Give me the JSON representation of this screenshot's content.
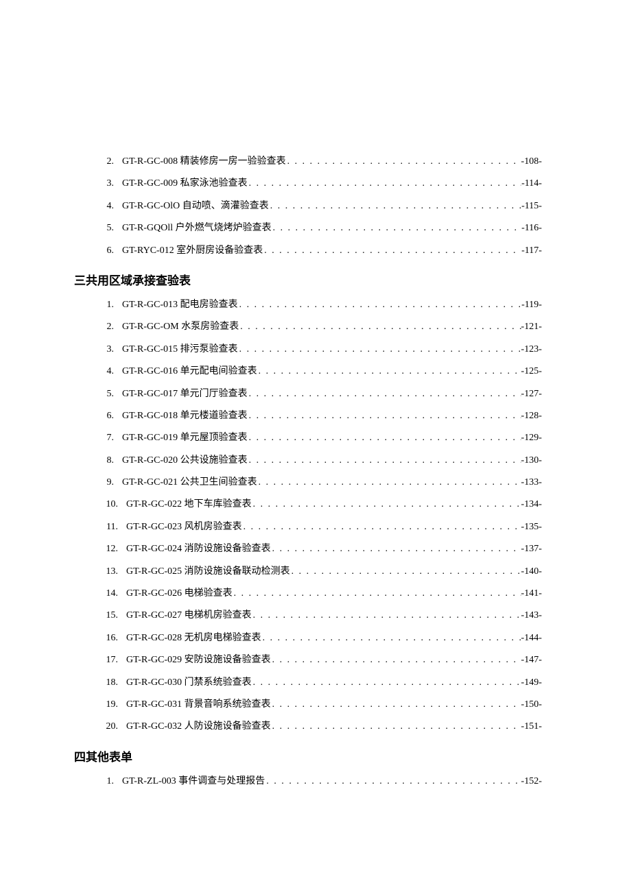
{
  "dots": ". . . . . . . . . . . . . . . . . . . . . . . . . . . . . . . . . . . . . . . . . . . . . . . . . . . . . . . . . . . . . . . .",
  "group1": {
    "items": [
      {
        "num": "2.",
        "title": "GT-R-GC-008 精装修房一房一验验查表",
        "page": "-108-"
      },
      {
        "num": "3.",
        "title": "GT-R-GC-009 私家泳池验查表",
        "page": "-114-"
      },
      {
        "num": "4.",
        "title": "GT-R-GC-OlO 自动喷、滴灌验查表",
        "page": "-115-"
      },
      {
        "num": "5.",
        "title": "GT-R-GQOll 户外燃气烧烤炉验查表",
        "page": "-116-"
      },
      {
        "num": "6.",
        "title": "GT-RYC-012 室外厨房设备验查表",
        "page": "-117-"
      }
    ]
  },
  "group2": {
    "heading": "三共用区域承接查验表",
    "items": [
      {
        "num": "1.",
        "title": "GT-R-GC-013 配电房验查表",
        "page": "-119-"
      },
      {
        "num": "2.",
        "title": "GT-R-GC-OM 水泵房验查表",
        "page": "-121-"
      },
      {
        "num": "3.",
        "title": "GT-R-GC-015 排污泵验查表",
        "page": "-123-"
      },
      {
        "num": "4.",
        "title": "GT-R-GC-016 单元配电间验查表",
        "page": "-125-"
      },
      {
        "num": "5.",
        "title": "GT-R-GC-017 单元门厅验查表",
        "page": "-127-"
      },
      {
        "num": "6.",
        "title": "GT-R-GC-018 单元楼道验查表",
        "page": "-128-"
      },
      {
        "num": "7.",
        "title": "GT-R-GC-019 单元屋顶验查表",
        "page": "-129-"
      },
      {
        "num": "8.",
        "title": "GT-R-GC-020 公共设施验查表",
        "page": "-130-"
      },
      {
        "num": "9.",
        "title": "GT-R-GC-021 公共卫生间验查表",
        "page": "-133-"
      },
      {
        "num": "10.",
        "title": "GT-R-GC-022 地下车库验查表",
        "page": "-134-"
      },
      {
        "num": "11.",
        "title": "GT-R-GC-023 风机房验查表",
        "page": "-135-"
      },
      {
        "num": "12.",
        "title": "GT-R-GC-024 消防设施设备验查表",
        "page": "-137-"
      },
      {
        "num": "13.",
        "title": "GT-R-GC-025 消防设施设备联动检测表",
        "page": "-140-"
      },
      {
        "num": "14.",
        "title": "GT-R-GC-026 电梯验查表",
        "page": "-141-"
      },
      {
        "num": "15.",
        "title": "GT-R-GC-027 电梯机房验查表",
        "page": "-143-"
      },
      {
        "num": "16.",
        "title": "GT-R-GC-028 无机房电梯验查表",
        "page": "-144-"
      },
      {
        "num": "17.",
        "title": "GT-R-GC-029 安防设施设备验查表",
        "page": "-147-"
      },
      {
        "num": "18.",
        "title": "GT-R-GC-030 门禁系统验查表",
        "page": "-149-"
      },
      {
        "num": "19.",
        "title": "GT-R-GC-031 背景音响系统验查表",
        "page": "-150-"
      },
      {
        "num": "20.",
        "title": "GT-R-GC-032 人防设施设备验查表",
        "page": "-151-"
      }
    ]
  },
  "group3": {
    "heading": "四其他表单",
    "items": [
      {
        "num": "1.",
        "title": "GT-R-ZL-003 事件调查与处理报告",
        "page": "-152-"
      }
    ]
  }
}
